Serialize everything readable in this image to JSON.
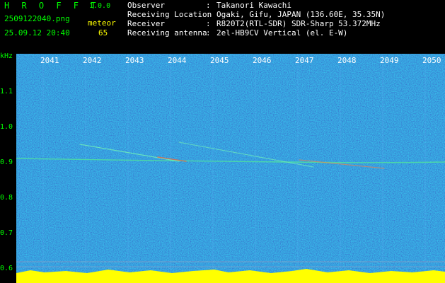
{
  "app": {
    "title": "H R O F F T",
    "version": "1.0.0"
  },
  "file": {
    "name": "2509122040.png",
    "datetime": "25.09.12 20:40"
  },
  "counter": {
    "label": "meteor",
    "value": "65"
  },
  "meta": [
    {
      "key": "Observer",
      "sep": ":",
      "value": "Takanori Kawachi"
    },
    {
      "key": "Receiving Location",
      "sep": ":",
      "value": "Ogaki, Gifu, JAPAN (136.60E, 35.35N)"
    },
    {
      "key": "Receiver",
      "sep": ":",
      "value": "R820T2(RTL-SDR) SDR-Sharp 53.372MHz"
    },
    {
      "key": "Receiving antenna",
      "sep": ":",
      "value": "2el-HB9CV Vertical (el. E-W)"
    }
  ],
  "axis": {
    "y_unit": "kHz",
    "y_ticks": [
      "1.1",
      "1.0",
      "0.9",
      "0.8",
      "0.7",
      "0.6"
    ],
    "x_ticks": [
      "2041",
      "2042",
      "2043",
      "2044",
      "2045",
      "2046",
      "2047",
      "2048",
      "2049",
      "2050"
    ]
  },
  "colors": {
    "background": "#000000",
    "spectrogram_base": "#1428b4",
    "header_green": "#00ff00",
    "counter_yellow": "#ffff00",
    "meta_white": "#ffffff",
    "signal_bar": "#ffff00"
  }
}
